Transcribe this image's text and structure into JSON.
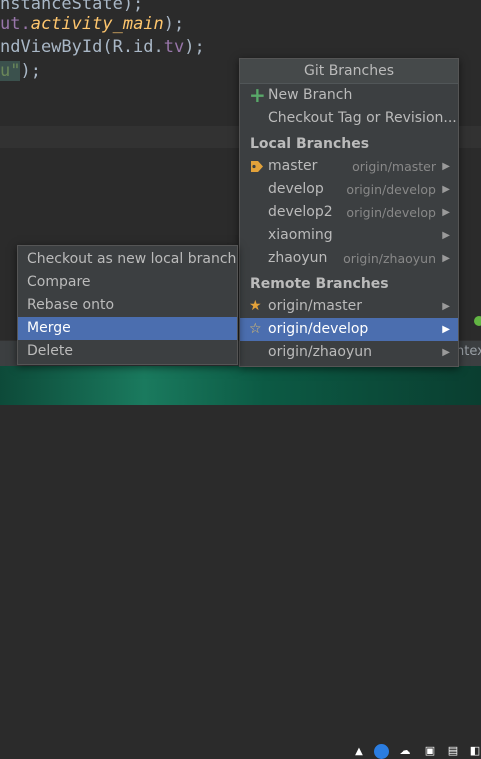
{
  "editor": {
    "lines": [
      {
        "plain": "nstanceState);"
      },
      {
        "pre": "ut.",
        "method": "activity_main",
        "post": ");"
      },
      {
        "pre": "ndViewById(R.id.",
        "field": "tv",
        "post": ");"
      },
      {
        "string": "u\"",
        "post": ");"
      }
    ]
  },
  "git_branches": {
    "title": "Git Branches",
    "new_branch": "New Branch",
    "checkout_tag": "Checkout Tag or Revision...",
    "local_header": "Local Branches",
    "local": [
      {
        "name": "master",
        "track": "origin/master",
        "icon": "tag-icon"
      },
      {
        "name": "develop",
        "track": "origin/develop"
      },
      {
        "name": "develop2",
        "track": "origin/develop"
      },
      {
        "name": "xiaoming",
        "track": ""
      },
      {
        "name": "zhaoyun",
        "track": "origin/zhaoyun"
      }
    ],
    "remote_header": "Remote Branches",
    "remote": [
      {
        "name": "origin/master",
        "icon": "star-filled-icon"
      },
      {
        "name": "origin/develop",
        "icon": "star-outline-icon",
        "selected": true
      },
      {
        "name": "origin/zhaoyun"
      }
    ]
  },
  "branch_actions": {
    "items": [
      {
        "label": "Checkout as new local branch"
      },
      {
        "label": "Compare"
      },
      {
        "label": "Rebase onto"
      },
      {
        "label": "Merge",
        "selected": true
      },
      {
        "label": "Delete"
      }
    ]
  },
  "strip": {
    "text": "ntex"
  },
  "colors": {
    "selection": "#4b6eaf",
    "popup_bg": "#3c3f41",
    "text": "#bbbbbb",
    "track": "#888888",
    "new_branch_plus": "#59a869",
    "star": "#e3a23a"
  }
}
